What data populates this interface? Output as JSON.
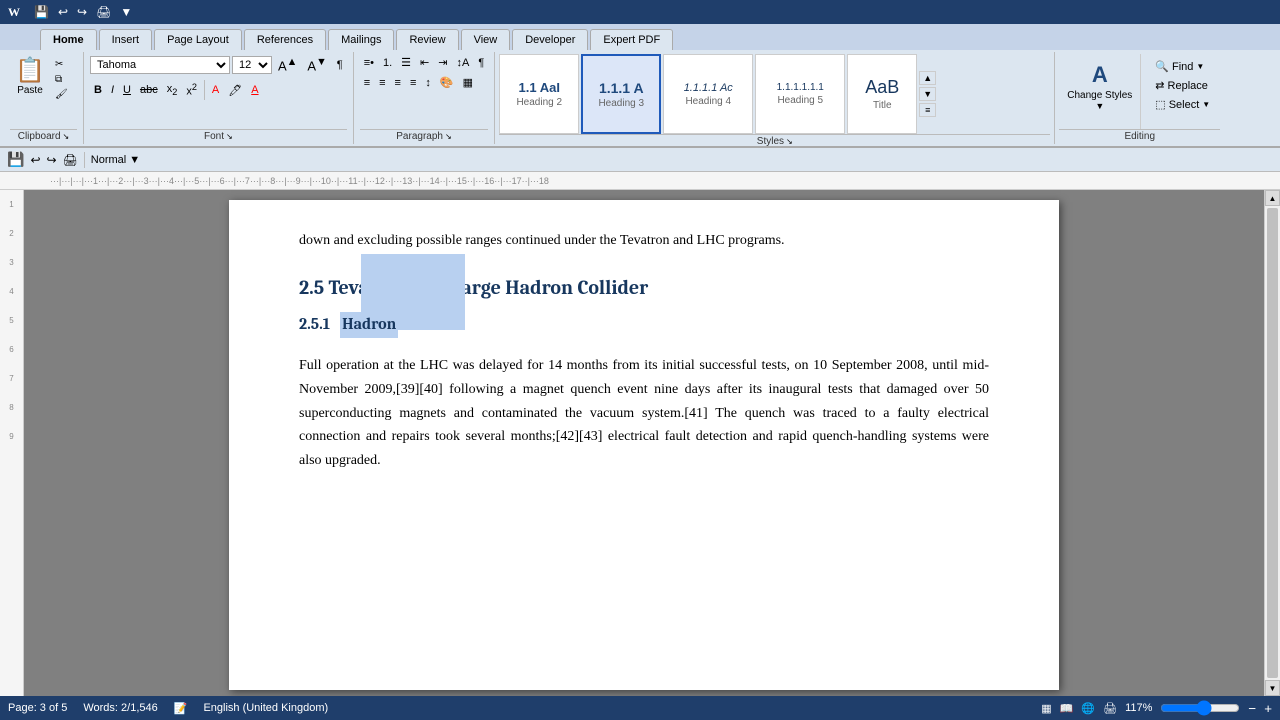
{
  "app": {
    "title": "Microsoft Word"
  },
  "tabs": {
    "items": [
      "Home",
      "Insert",
      "Page Layout",
      "References",
      "Mailings",
      "Review",
      "View",
      "Developer",
      "Expert PDF"
    ],
    "active": "Home"
  },
  "ribbon": {
    "clipboard": {
      "label": "Clipboard",
      "paste_label": "Paste",
      "cut_icon": "✂",
      "copy_icon": "⧉",
      "format_painter_icon": "🖌"
    },
    "font": {
      "label": "Font",
      "current_font": "Tahoma",
      "current_size": "12",
      "bold_label": "B",
      "italic_label": "I",
      "underline_label": "U"
    },
    "paragraph": {
      "label": "Paragraph"
    },
    "styles": {
      "label": "Styles",
      "items": [
        {
          "id": "h2",
          "display": "1.1  AaI",
          "subtext": "Heading 2",
          "active": false
        },
        {
          "id": "h3",
          "display": "1.1.1  A",
          "subtext": "Heading 3",
          "active": true
        },
        {
          "id": "h4",
          "display": "1.1.1.1 Ac",
          "subtext": "Heading 4",
          "active": false
        },
        {
          "id": "h5",
          "display": "1.1.1.1.1.1",
          "subtext": "Heading 5",
          "active": false
        },
        {
          "id": "title",
          "display": "AaB",
          "subtext": "Title",
          "active": false
        }
      ],
      "change_styles_label": "Change Styles",
      "change_styles_icon": "A"
    },
    "editing": {
      "label": "Editing",
      "find_label": "Find",
      "replace_label": "Replace",
      "select_label": "Select"
    }
  },
  "toolbar": {
    "qat_items": [
      "💾",
      "↩",
      "↪",
      "🖨",
      "⊞"
    ]
  },
  "document": {
    "intro_text": "down and excluding possible ranges continued under the Tevatron and LHC programs.",
    "heading_2_5": "2.5   Tevatron and Large Hadron Collider",
    "heading_2_5_1_num": "2.5.1",
    "heading_2_5_1_word_selected": "Hadron",
    "body_paragraph": "Full operation at the LHC was delayed for 14 months from its initial successful tests, on 10 September 2008, until mid-November 2009,[39][40] following a magnet quench event nine days after its inaugural tests that damaged over 50 superconducting magnets and contaminated the vacuum system.[41] The quench was traced to a faulty electrical connection and repairs took several months;[42][43] electrical fault detection and rapid quench-handling systems were also upgraded."
  },
  "status_bar": {
    "page": "Page: 3 of 5",
    "words": "Words: 2/1,546",
    "language": "English (United Kingdom)",
    "zoom": "117%"
  }
}
